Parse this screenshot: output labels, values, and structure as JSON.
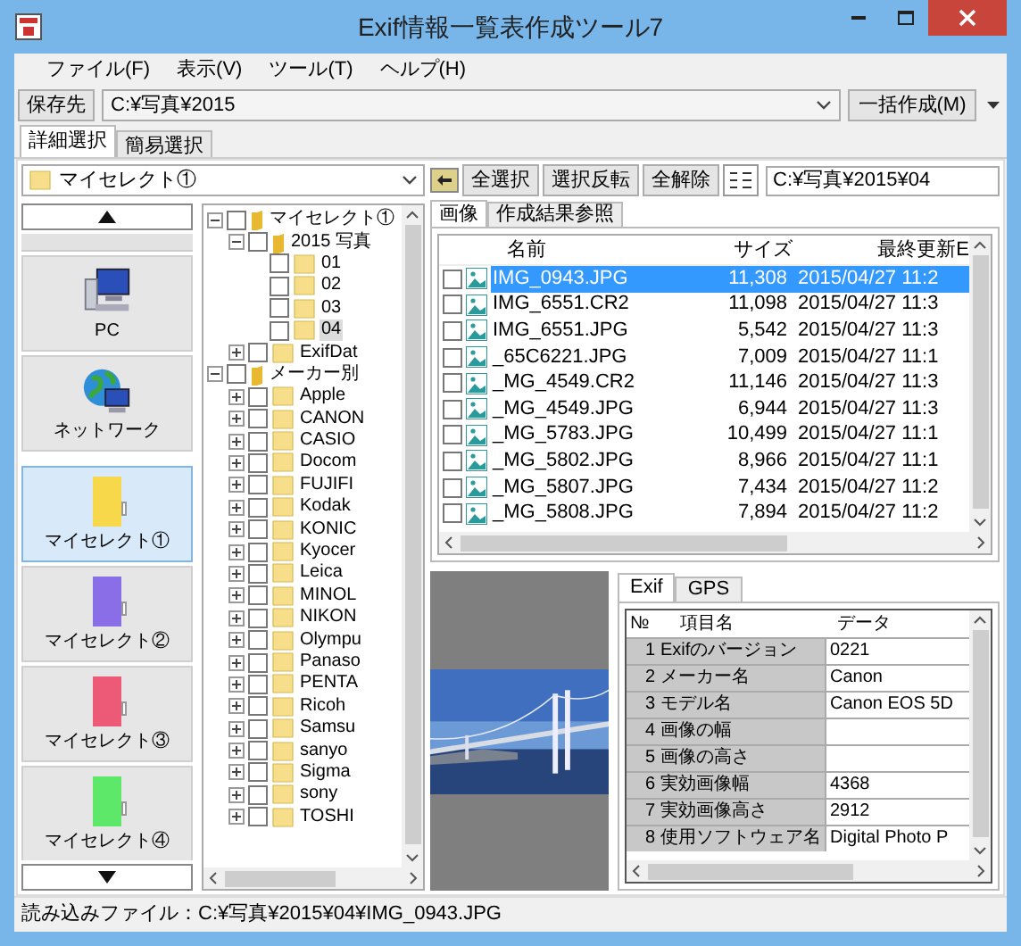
{
  "window": {
    "title": "Exif情報一覧表作成ツール7"
  },
  "menu": [
    "ファイル(F)",
    "表示(V)",
    "ツール(T)",
    "ヘルプ(H)"
  ],
  "save_bar": {
    "button": "保存先",
    "path": "C:¥写真¥2015",
    "run_button": "一括作成(M)"
  },
  "tabs": [
    {
      "label": "詳細選択",
      "selected": true
    },
    {
      "label": "簡易選択",
      "selected": false
    }
  ],
  "folder_combo": "マイセレクト①",
  "nav": [
    {
      "label": "PC",
      "kind": "pc",
      "selected": false
    },
    {
      "label": "ネットワーク",
      "kind": "network",
      "selected": false
    },
    {
      "label": "マイセレクト①",
      "kind": "folder",
      "color": "#f7d84a",
      "selected": true
    },
    {
      "label": "マイセレクト②",
      "kind": "folder",
      "color": "#8a6ee8",
      "selected": false
    },
    {
      "label": "マイセレクト③",
      "kind": "folder",
      "color": "#ec5a78",
      "selected": false
    },
    {
      "label": "マイセレクト④",
      "kind": "folder",
      "color": "#5ee86a",
      "selected": false
    }
  ],
  "tree": [
    {
      "label": "マイセレクト①",
      "checked": false,
      "selected": false,
      "expanded": true,
      "children": [
        {
          "label": "2015 写真",
          "checked": false,
          "selected": false,
          "expanded": true,
          "children": [
            {
              "label": "01",
              "checked": false,
              "selected": false
            },
            {
              "label": "02",
              "checked": false,
              "selected": false
            },
            {
              "label": "03",
              "checked": false,
              "selected": false
            },
            {
              "label": "04",
              "checked": false,
              "selected": true
            }
          ]
        },
        {
          "label": "ExifDat",
          "checked": false,
          "selected": false,
          "expanded": false
        }
      ]
    },
    {
      "label": "メーカー別",
      "checked": false,
      "selected": false,
      "expanded": true,
      "children": [
        {
          "label": "Apple",
          "checked": false,
          "selected": false,
          "expanded": false
        },
        {
          "label": "CANON",
          "checked": false,
          "selected": false,
          "expanded": false
        },
        {
          "label": "CASIO",
          "checked": false,
          "selected": false,
          "expanded": false
        },
        {
          "label": "Docom",
          "checked": false,
          "selected": false,
          "expanded": false
        },
        {
          "label": "FUJIFI",
          "checked": false,
          "selected": false,
          "expanded": false
        },
        {
          "label": "Kodak",
          "checked": false,
          "selected": false,
          "expanded": false
        },
        {
          "label": "KONIC",
          "checked": false,
          "selected": false,
          "expanded": false
        },
        {
          "label": "Kyocer",
          "checked": false,
          "selected": false,
          "expanded": false
        },
        {
          "label": "Leica",
          "checked": false,
          "selected": false,
          "expanded": false
        },
        {
          "label": "MINOL",
          "checked": false,
          "selected": false,
          "expanded": false
        },
        {
          "label": "NIKON",
          "checked": false,
          "selected": false,
          "expanded": false
        },
        {
          "label": "Olympu",
          "checked": false,
          "selected": false,
          "expanded": false
        },
        {
          "label": "Panaso",
          "checked": false,
          "selected": false,
          "expanded": false
        },
        {
          "label": "PENTA",
          "checked": false,
          "selected": false,
          "expanded": false
        },
        {
          "label": "Ricoh",
          "checked": false,
          "selected": false,
          "expanded": false
        },
        {
          "label": "Samsu",
          "checked": false,
          "selected": false,
          "expanded": false
        },
        {
          "label": "sanyo",
          "checked": false,
          "selected": false,
          "expanded": false
        },
        {
          "label": "Sigma",
          "checked": false,
          "selected": false,
          "expanded": false
        },
        {
          "label": "sony",
          "checked": false,
          "selected": false,
          "expanded": false
        },
        {
          "label": "TOSHI",
          "checked": false,
          "selected": false,
          "expanded": false
        }
      ]
    }
  ],
  "file_toolbar": {
    "buttons": [
      "全選択",
      "選択反転",
      "全解除"
    ],
    "path": "C:¥写真¥2015¥04"
  },
  "file_tabs": [
    {
      "label": "画像",
      "selected": true
    },
    {
      "label": "作成結果参照",
      "selected": false
    }
  ],
  "file_list": {
    "columns": [
      "名前",
      "サイズ",
      "最終更新E"
    ],
    "rows": [
      {
        "name": "IMG_0943.JPG",
        "size": "11,308",
        "date": "2015/04/27 11:2",
        "checked": false,
        "selected": true
      },
      {
        "name": "IMG_6551.CR2",
        "size": "11,098",
        "date": "2015/04/27 11:3",
        "checked": false,
        "selected": false
      },
      {
        "name": "IMG_6551.JPG",
        "size": "5,542",
        "date": "2015/04/27 11:3",
        "checked": false,
        "selected": false
      },
      {
        "name": "_65C6221.JPG",
        "size": "7,009",
        "date": "2015/04/27 11:1",
        "checked": false,
        "selected": false
      },
      {
        "name": "_MG_4549.CR2",
        "size": "11,146",
        "date": "2015/04/27 11:3",
        "checked": false,
        "selected": false
      },
      {
        "name": "_MG_4549.JPG",
        "size": "6,944",
        "date": "2015/04/27 11:3",
        "checked": false,
        "selected": false
      },
      {
        "name": "_MG_5783.JPG",
        "size": "10,499",
        "date": "2015/04/27 11:1",
        "checked": false,
        "selected": false
      },
      {
        "name": "_MG_5802.JPG",
        "size": "8,966",
        "date": "2015/04/27 11:1",
        "checked": false,
        "selected": false
      },
      {
        "name": "_MG_5807.JPG",
        "size": "7,434",
        "date": "2015/04/27 11:2",
        "checked": false,
        "selected": false
      },
      {
        "name": "_MG_5808.JPG",
        "size": "7,894",
        "date": "2015/04/27 11:2",
        "checked": false,
        "selected": false
      }
    ]
  },
  "exif_tabs": [
    {
      "label": "Exif",
      "selected": true
    },
    {
      "label": "GPS",
      "selected": false
    }
  ],
  "exif_table": {
    "columns": [
      "№",
      "項目名",
      "データ"
    ],
    "rows": [
      {
        "no": "1",
        "name": "Exifのバージョン",
        "value": "0221"
      },
      {
        "no": "2",
        "name": "メーカー名",
        "value": "Canon"
      },
      {
        "no": "3",
        "name": "モデル名",
        "value": "Canon EOS 5D"
      },
      {
        "no": "4",
        "name": "画像の幅"
      },
      {
        "no": "5",
        "name": "画像の高さ"
      },
      {
        "no": "6",
        "name": "実効画像幅",
        "value": "4368"
      },
      {
        "no": "7",
        "name": "実効画像高さ",
        "value": "2912"
      },
      {
        "no": "8",
        "name": "使用ソフトウェア名",
        "value": "Digital Photo P"
      }
    ]
  },
  "status_bar": "読み込みファイル：C:¥写真¥2015¥04¥IMG_0943.JPG"
}
